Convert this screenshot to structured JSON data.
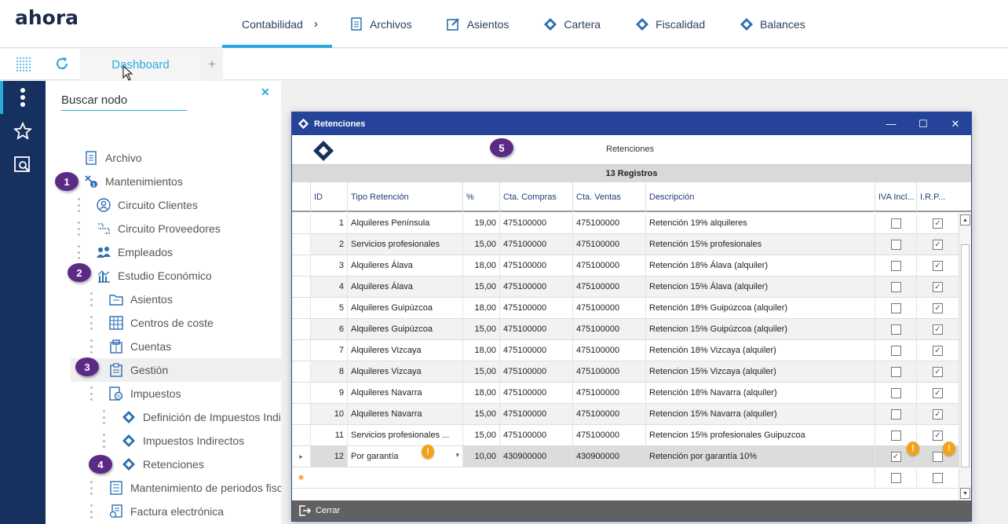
{
  "app": {
    "logo": "ahora"
  },
  "nav": {
    "items": [
      {
        "label": "Contabilidad",
        "icon": "chevron-right-icon",
        "active": true
      },
      {
        "label": "Archivos",
        "icon": "document-icon"
      },
      {
        "label": "Asientos",
        "icon": "edit-icon"
      },
      {
        "label": "Cartera",
        "icon": "diamond-icon"
      },
      {
        "label": "Fiscalidad",
        "icon": "diamond-icon"
      },
      {
        "label": "Balances",
        "icon": "diamond-icon"
      }
    ],
    "chevron": "›"
  },
  "tabs": {
    "dashboard": "Dashboard",
    "add": "+"
  },
  "sidebar": {
    "search_placeholder": "Buscar nodo",
    "close": "✕",
    "items": [
      {
        "label": "Archivo"
      },
      {
        "label": "Mantenimientos"
      },
      {
        "label": "Circuito Clientes"
      },
      {
        "label": "Circuito Proveedores"
      },
      {
        "label": "Empleados"
      },
      {
        "label": "Estudio Económico"
      },
      {
        "label": "Asientos"
      },
      {
        "label": "Centros de coste"
      },
      {
        "label": "Cuentas"
      },
      {
        "label": "Gestión"
      },
      {
        "label": "Impuestos"
      },
      {
        "label": "Definición de Impuestos Indirectos"
      },
      {
        "label": "Impuestos Indirectos"
      },
      {
        "label": "Retenciones"
      },
      {
        "label": "Mantenimiento de periodos fiscales"
      },
      {
        "label": "Factura electrónica"
      }
    ]
  },
  "badges": [
    "1",
    "2",
    "3",
    "4",
    "5"
  ],
  "window": {
    "title": "Retenciones",
    "header_title": "Retenciones",
    "record_count": "13 Registros",
    "minimize": "—",
    "maximize": "☐",
    "close": "✕",
    "footer_close": "Cerrar",
    "columns": [
      "ID",
      "Tipo Retención",
      "%",
      "Cta. Compras",
      "Cta. Ventas",
      "Descripción",
      "IVA Incl...",
      "I.R.P..."
    ],
    "rows": [
      {
        "id": "1",
        "tipo": "Alquileres Península",
        "pct": "19,00",
        "compras": "475100000",
        "ventas": "475100000",
        "desc": "Retención 19% alquileres",
        "iva": false,
        "irpf": true
      },
      {
        "id": "2",
        "tipo": "Servicios profesionales",
        "pct": "15,00",
        "compras": "475100000",
        "ventas": "475100000",
        "desc": "Retención 15% profesionales",
        "iva": false,
        "irpf": true
      },
      {
        "id": "3",
        "tipo": "Alquileres Álava",
        "pct": "18,00",
        "compras": "475100000",
        "ventas": "475100000",
        "desc": "Retención 18% Álava (alquiler)",
        "iva": false,
        "irpf": true
      },
      {
        "id": "4",
        "tipo": "Alquileres Álava",
        "pct": "15,00",
        "compras": "475100000",
        "ventas": "475100000",
        "desc": "Retencion 15% Álava (alquiler)",
        "iva": false,
        "irpf": true
      },
      {
        "id": "5",
        "tipo": "Alquileres Guipúzcoa",
        "pct": "18,00",
        "compras": "475100000",
        "ventas": "475100000",
        "desc": "Retención 18% Guipúzcoa (alquiler)",
        "iva": false,
        "irpf": true
      },
      {
        "id": "6",
        "tipo": "Alquileres Guipúzcoa",
        "pct": "15,00",
        "compras": "475100000",
        "ventas": "475100000",
        "desc": "Retencion 15% Guipúzcoa (alquiler)",
        "iva": false,
        "irpf": true
      },
      {
        "id": "7",
        "tipo": "Alquileres Vizcaya",
        "pct": "18,00",
        "compras": "475100000",
        "ventas": "475100000",
        "desc": "Retención 18% Vizcaya (alquiler)",
        "iva": false,
        "irpf": true
      },
      {
        "id": "8",
        "tipo": "Alquileres Vizcaya",
        "pct": "15,00",
        "compras": "475100000",
        "ventas": "475100000",
        "desc": "Retencion 15% Vizcaya (alquiler)",
        "iva": false,
        "irpf": true
      },
      {
        "id": "9",
        "tipo": "Alquileres Navarra",
        "pct": "18,00",
        "compras": "475100000",
        "ventas": "475100000",
        "desc": "Retención 18% Navarra (alquiler)",
        "iva": false,
        "irpf": true
      },
      {
        "id": "10",
        "tipo": "Alquileres Navarra",
        "pct": "15,00",
        "compras": "475100000",
        "ventas": "475100000",
        "desc": "Retencion 15% Navarra (alquiler)",
        "iva": false,
        "irpf": true
      },
      {
        "id": "11",
        "tipo": "Servicios profesionales ...",
        "pct": "15,00",
        "compras": "475100000",
        "ventas": "475100000",
        "desc": "Retencion 15% profesionales Guipuzcoa",
        "iva": false,
        "irpf": true
      },
      {
        "id": "12",
        "tipo": "Por garantía",
        "pct": "10,00",
        "compras": "430900000",
        "ventas": "430900000",
        "desc": "Retención por garantía 10%",
        "iva": true,
        "irpf": false
      }
    ],
    "warning": "!",
    "new_row_marker": "✱",
    "current_row_marker": "▸"
  },
  "colors": {
    "accent": "#2aa9e0",
    "navy": "#16305f",
    "window_title": "#26439a",
    "badge": "#5b2a86",
    "warning": "#f3a21a"
  }
}
